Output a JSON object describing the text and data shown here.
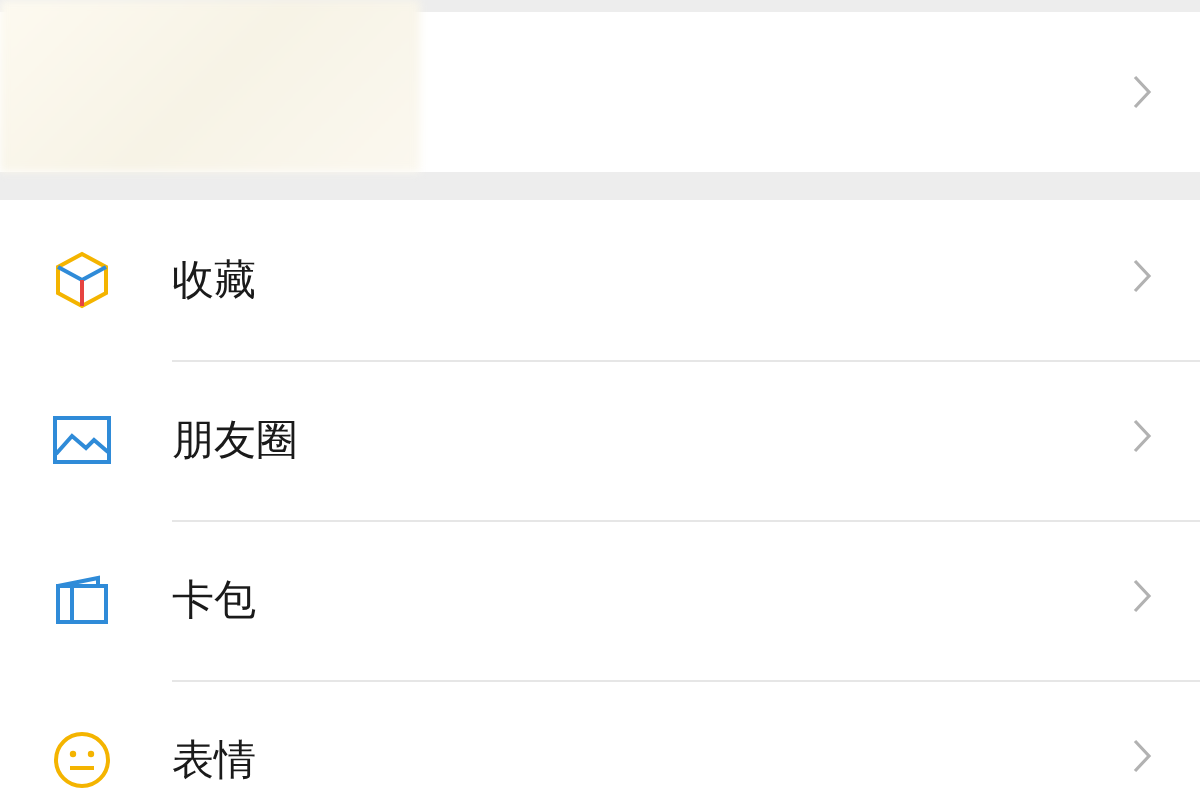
{
  "profile_card": {
    "blurred": true
  },
  "menu_items": [
    {
      "kind": "cube",
      "label": "收藏"
    },
    {
      "kind": "image",
      "label": "朋友圈"
    },
    {
      "kind": "card",
      "label": "卡包"
    },
    {
      "kind": "smiley",
      "label": "表情"
    }
  ]
}
